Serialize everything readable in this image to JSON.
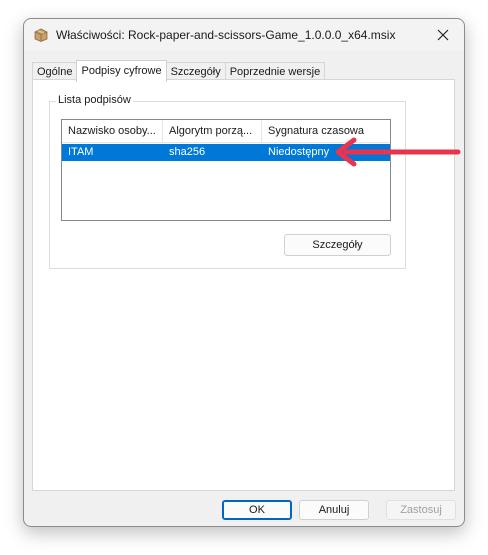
{
  "window": {
    "title": "Właściwości: Rock-paper-and-scissors-Game_1.0.0.0_x64.msix"
  },
  "tabs": [
    {
      "label": "Ogólne"
    },
    {
      "label": "Podpisy cyfrowe"
    },
    {
      "label": "Szczegóły"
    },
    {
      "label": "Poprzednie wersje"
    }
  ],
  "signatures": {
    "group_label": "Lista podpisów",
    "columns": [
      "Nazwisko osoby...",
      "Algorytm porzą...",
      "Sygnatura czasowa"
    ],
    "rows": [
      {
        "name": "ITAM",
        "algorithm": "sha256",
        "timestamp": "Niedostępny"
      }
    ],
    "details_button": "Szczegóły"
  },
  "footer": {
    "ok": "OK",
    "cancel": "Anuluj",
    "apply": "Zastosuj"
  },
  "colors": {
    "selection": "#0078d7",
    "annotation_arrow": "#e8344e",
    "default_button_border": "#0067c0"
  },
  "icons": {
    "app": "package-icon",
    "close": "close-icon",
    "annotation": "red-arrow-icon"
  }
}
